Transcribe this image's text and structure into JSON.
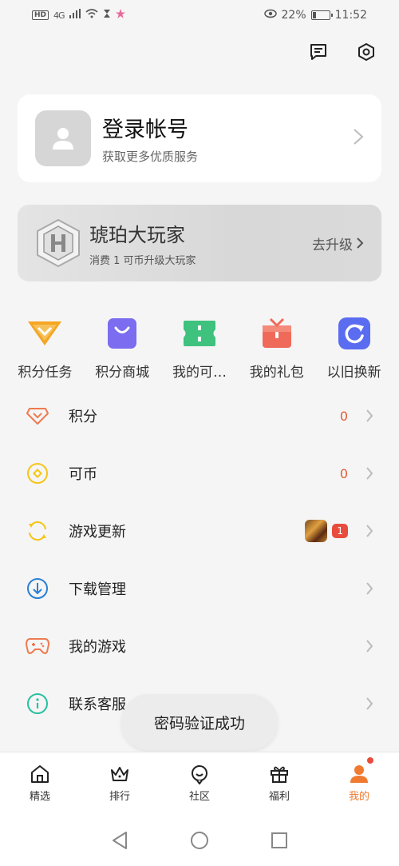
{
  "status_bar": {
    "hd": "HD",
    "network": "4G",
    "battery_text": "22%",
    "battery_level": 0.22,
    "time": "11:52"
  },
  "top_icons": [
    "message-icon",
    "settings-icon"
  ],
  "login": {
    "title": "登录帐号",
    "subtitle": "获取更多优质服务"
  },
  "level": {
    "title": "琥珀大玩家",
    "subtitle": "消费 1 可币升级大玩家",
    "upgrade_label": "去升级"
  },
  "quick_actions": [
    {
      "label": "积分任务",
      "icon": "points-task-icon",
      "color": "#f5a623"
    },
    {
      "label": "积分商城",
      "icon": "points-mall-icon",
      "color": "#7b6cf0"
    },
    {
      "label": "我的可…",
      "icon": "my-coupon-icon",
      "color": "#3ec27d"
    },
    {
      "label": "我的礼包",
      "icon": "gift-pack-icon",
      "color": "#f06a5a"
    },
    {
      "label": "以旧换新",
      "icon": "trade-in-icon",
      "color": "#5a6cf0"
    }
  ],
  "menu": [
    {
      "label": "积分",
      "value": "0",
      "icon": "diamond-icon"
    },
    {
      "label": "可币",
      "value": "0",
      "icon": "coin-icon"
    },
    {
      "label": "游戏更新",
      "count": "1",
      "icon": "refresh-icon"
    },
    {
      "label": "下载管理",
      "icon": "download-icon"
    },
    {
      "label": "我的游戏",
      "icon": "gamepad-icon"
    },
    {
      "label": "联系客服",
      "icon": "info-icon"
    }
  ],
  "toast": "密码验证成功",
  "tabs": [
    {
      "label": "精选",
      "icon": "home-icon"
    },
    {
      "label": "排行",
      "icon": "crown-icon"
    },
    {
      "label": "社区",
      "icon": "community-icon"
    },
    {
      "label": "福利",
      "icon": "gift-icon"
    },
    {
      "label": "我的",
      "icon": "person-icon",
      "active": true
    }
  ],
  "accent_color": "#f07a30"
}
